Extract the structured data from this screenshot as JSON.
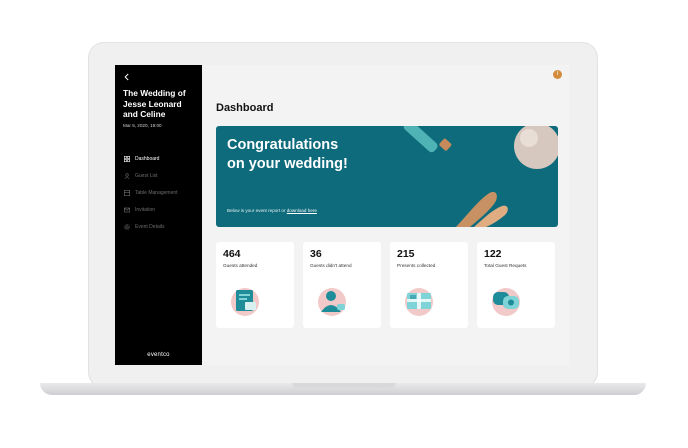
{
  "sidebar": {
    "back_icon": "chevron-left-icon",
    "event_title": "The Wedding of Jesse Leonard and Celine",
    "event_date": "Mar 5, 2020, 19:00",
    "items": [
      {
        "label": "Dashboard",
        "icon": "grid-icon",
        "active": true
      },
      {
        "label": "Guest List",
        "icon": "user-icon",
        "active": false
      },
      {
        "label": "Table Management",
        "icon": "table-icon",
        "active": false
      },
      {
        "label": "Invitation",
        "icon": "envelope-icon",
        "active": false
      },
      {
        "label": "Event Details",
        "icon": "settings-icon",
        "active": false
      }
    ],
    "brand": "eventco"
  },
  "header": {
    "avatar_initial": "I",
    "avatar_color": "#d38b3c"
  },
  "main": {
    "page_title": "Dashboard",
    "banner": {
      "heading_line1": "Congratulations",
      "heading_line2": "on your wedding!",
      "footer_text": "Below is your event report or ",
      "footer_link": "download here",
      "background": "#0e6b7c"
    },
    "stats": [
      {
        "value": "464",
        "label": "Guests attended",
        "icon": "invitation-card-icon"
      },
      {
        "value": "36",
        "label": "Guests didn't attend",
        "icon": "guest-avatar-icon"
      },
      {
        "value": "215",
        "label": "Presents collected",
        "icon": "gift-icon"
      },
      {
        "value": "122",
        "label": "Total Guest Requets",
        "icon": "chat-bubbles-icon"
      }
    ]
  }
}
